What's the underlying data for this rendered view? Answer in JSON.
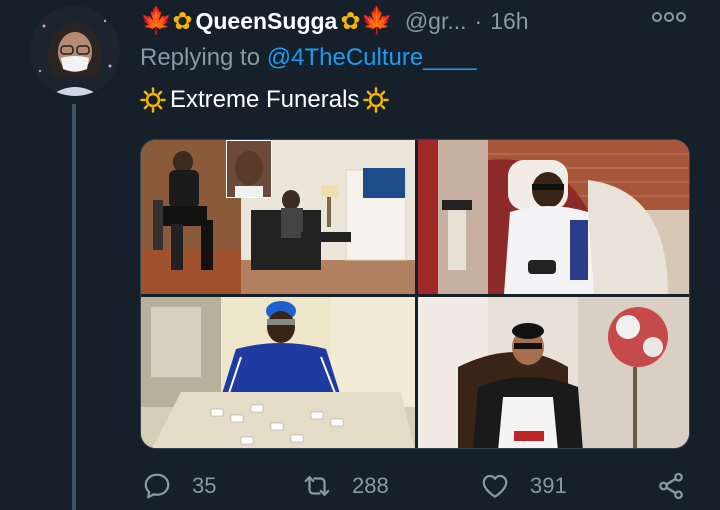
{
  "tweet": {
    "display_name": "QueenSugga",
    "handle": "@gr...",
    "separator": "·",
    "time": "16h",
    "replying_prefix": "Replying to",
    "replying_to": "@4TheCulture____",
    "text": "Extreme Funerals"
  },
  "actions": {
    "replies": "35",
    "retweets": "288",
    "likes": "391"
  },
  "colors": {
    "background": "#15202b",
    "accent": "#1d9bf0",
    "muted": "#8899a6"
  },
  "icons": [
    "maple-leaf-icon",
    "sunflower-icon",
    "sun-icon",
    "more-icon",
    "reply-icon",
    "retweet-icon",
    "like-icon",
    "share-icon"
  ]
}
